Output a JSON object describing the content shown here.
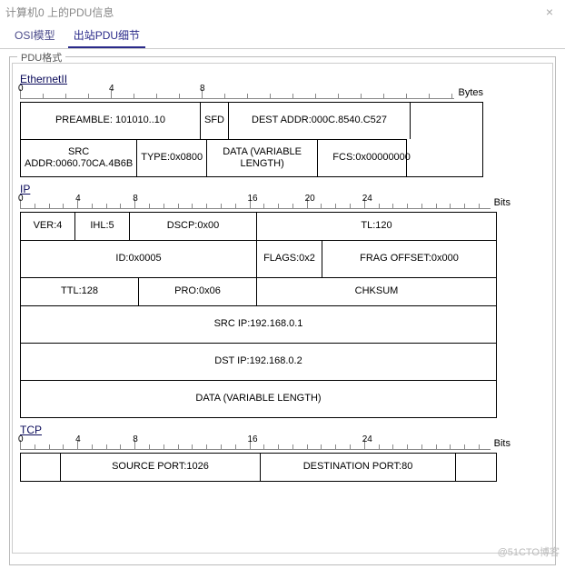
{
  "window": {
    "title": "计算机0 上的PDU信息"
  },
  "tabs": {
    "osi": "OSI模型",
    "outbound": "出站PDU细节"
  },
  "pdu": {
    "frame_label": "PDU格式"
  },
  "ethernet": {
    "title": "EthernetII",
    "ruler_unit": "Bytes",
    "ruler": [
      "0",
      "4",
      "8"
    ],
    "preamble": "PREAMBLE: 101010..10",
    "sfd": "SFD",
    "dest_addr": "DEST ADDR:000C.8540.C527",
    "src_addr": "SRC ADDR:0060.70CA.4B6B",
    "type": "TYPE:0x0800",
    "data": "DATA (VARIABLE LENGTH)",
    "fcs": "FCS:0x00000000"
  },
  "ip": {
    "title": "IP",
    "ruler_unit": "Bits",
    "ruler": [
      "0",
      "4",
      "8",
      "16",
      "20",
      "24"
    ],
    "ver": "VER:4",
    "ihl": "IHL:5",
    "dscp": "DSCP:0x00",
    "tl": "TL:120",
    "id": "ID:0x0005",
    "flags": "FLAGS:0x2",
    "frag": "FRAG OFFSET:0x000",
    "ttl": "TTL:128",
    "pro": "PRO:0x06",
    "chksum": "CHKSUM",
    "srcip": "SRC IP:192.168.0.1",
    "dstip": "DST IP:192.168.0.2",
    "data": "DATA (VARIABLE LENGTH)"
  },
  "tcp": {
    "title": "TCP",
    "ruler_unit": "Bits",
    "ruler": [
      "0",
      "4",
      "8",
      "16",
      "24"
    ],
    "srcport": "SOURCE PORT:1026",
    "dstport": "DESTINATION PORT:80"
  },
  "watermark": "@51CTO博客"
}
